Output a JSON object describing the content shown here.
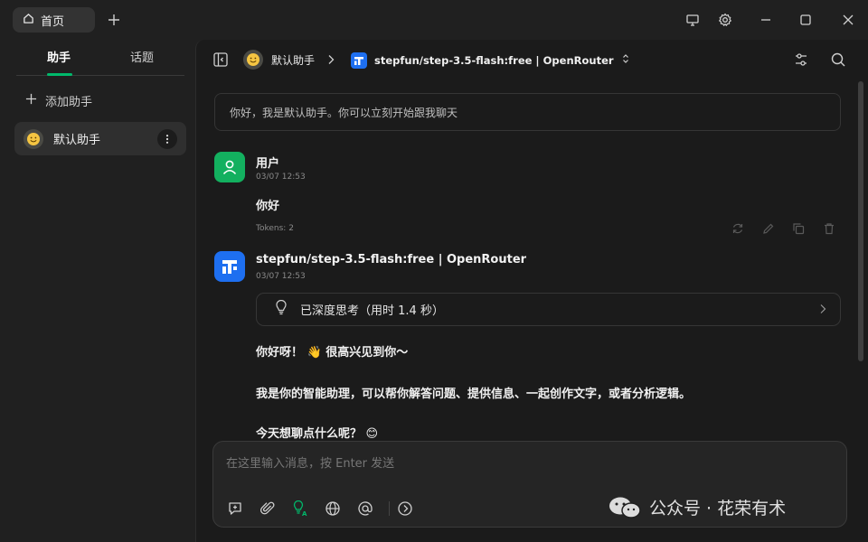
{
  "titlebar": {
    "tab_label": "首页",
    "icons": [
      "home-icon",
      "plus-icon",
      "monitor-icon",
      "settings-icon",
      "minimize-icon",
      "maximize-icon",
      "close-icon"
    ]
  },
  "sidebar": {
    "tabs": [
      "助手",
      "话题"
    ],
    "add_label": "添加助手",
    "assistants": [
      {
        "name": "默认助手"
      }
    ]
  },
  "header": {
    "assistant_name": "默认助手",
    "model_name": "stepfun/step-3.5-flash:free | OpenRouter"
  },
  "welcome_text": "你好，我是默认助手。你可以立刻开始跟我聊天",
  "messages": [
    {
      "name": "用户",
      "time": "03/07 12:53",
      "text": "你好",
      "tokens": "Tokens: 2"
    },
    {
      "name": "stepfun/step-3.5-flash:free | OpenRouter",
      "time": "03/07 12:53",
      "thinking_label": "已深度思考（用时 1.4 秒）",
      "lines": [
        "你好呀！ 👋 很高兴见到你～",
        "我是你的智能助理，可以帮你解答问题、提供信息、一起创作文字，或者分析逻辑。",
        "今天想聊点什么呢？ 😊"
      ]
    }
  ],
  "input": {
    "placeholder": "在这里输入消息，按 Enter 发送"
  },
  "watermark": "公众号 · 花荣有术",
  "colors": {
    "accent": "#00b96b",
    "user_avatar": "#13b05f",
    "model_logo": "#1e6ff0"
  }
}
